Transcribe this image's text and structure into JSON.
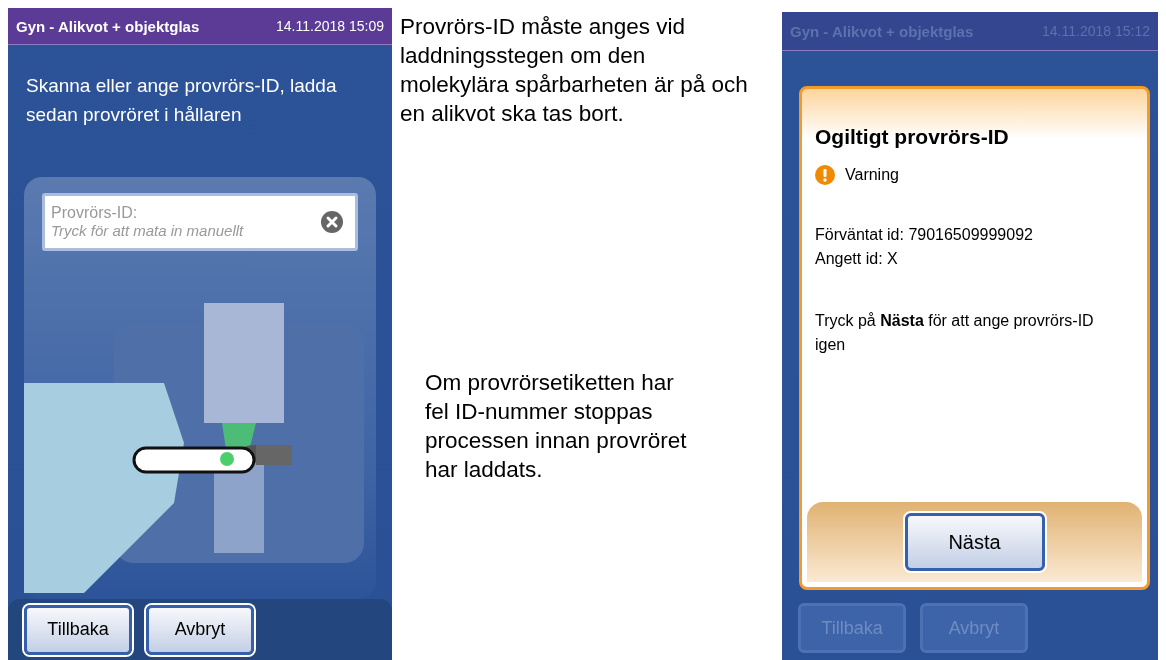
{
  "left_screen": {
    "title": "Gyn - Alikvot + objektglas",
    "datetime": "14.11.2018 15:09",
    "instruction": "Skanna eller ange provrörs-ID, ladda sedan provröret i hållaren",
    "id_field": {
      "label": "Provrörs-ID:",
      "placeholder": "Tryck för att mata in manuellt"
    },
    "buttons": [
      {
        "label": "Tillbaka",
        "disabled": false
      },
      {
        "label": "Avbryt",
        "disabled": false
      }
    ]
  },
  "captions": [
    "Provrörs-ID måste anges vid laddningsstegen om den molekylära spårbarheten är på och en alikvot ska tas bort.",
    "Om provrörsetiketten har fel ID-nummer stoppas processen innan provröret har laddats."
  ],
  "right_screen": {
    "title": "Gyn - Alikvot + objektglas",
    "datetime": "14.11.2018 15:12",
    "dialog": {
      "title": "Ogiltigt provrörs-ID",
      "severity": "Varning",
      "lines": [
        "Förväntat id: 79016509999092",
        "Angett id: X"
      ],
      "message": "Tryck på **Nästa** för att ange provrörs-ID igen",
      "button": "Nästa"
    },
    "buttons": [
      {
        "label": "Tillbaka",
        "disabled": true
      },
      {
        "label": "Avbryt",
        "disabled": true
      }
    ]
  }
}
